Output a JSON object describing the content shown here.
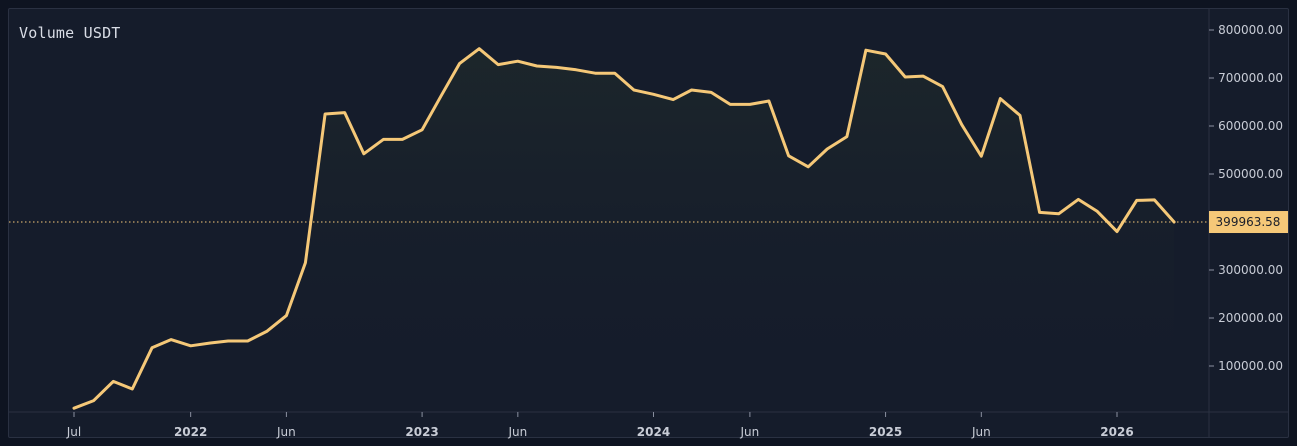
{
  "chart_data": {
    "type": "area",
    "title": "Volume USDT",
    "colors": {
      "line": "#f5c878",
      "background": "#151c2b",
      "label_bg": "#f5c878"
    },
    "ylim": [
      0,
      830000
    ],
    "y_ticks": [
      100000,
      200000,
      300000,
      400000,
      500000,
      600000,
      700000,
      800000
    ],
    "y_tick_labels": [
      "100000.00",
      "200000.00",
      "300000.00",
      "400000.00",
      "500000.00",
      "600000.00",
      "700000.00",
      "800000.00"
    ],
    "x_ticks": [
      {
        "label": "Jul",
        "date": "2021-07-01",
        "bold": false
      },
      {
        "label": "2022",
        "date": "2022-01-01",
        "bold": true
      },
      {
        "label": "Jun",
        "date": "2022-06-01",
        "bold": false
      },
      {
        "label": "2023",
        "date": "2023-01-01",
        "bold": true
      },
      {
        "label": "Jun",
        "date": "2023-06-01",
        "bold": false
      },
      {
        "label": "2024",
        "date": "2024-01-01",
        "bold": true
      },
      {
        "label": "Jun",
        "date": "2024-06-01",
        "bold": false
      },
      {
        "label": "2025",
        "date": "2025-01-01",
        "bold": true
      },
      {
        "label": "Jun",
        "date": "2025-06-01",
        "bold": false
      },
      {
        "label": "2026",
        "date": "2026-01-01",
        "bold": true
      }
    ],
    "last_value_label": "399963.58",
    "series": [
      {
        "points": [
          [
            "2021-07-01",
            12000
          ],
          [
            "2021-08-01",
            28000
          ],
          [
            "2021-09-01",
            68000
          ],
          [
            "2021-10-01",
            52000
          ],
          [
            "2021-11-01",
            138000
          ],
          [
            "2021-12-01",
            155000
          ],
          [
            "2022-01-01",
            142000
          ],
          [
            "2022-02-01",
            148000
          ],
          [
            "2022-03-01",
            152000
          ],
          [
            "2022-04-01",
            152000
          ],
          [
            "2022-05-01",
            172000
          ],
          [
            "2022-06-01",
            205000
          ],
          [
            "2022-07-01",
            315000
          ],
          [
            "2022-08-01",
            625000
          ],
          [
            "2022-09-01",
            628000
          ],
          [
            "2022-10-01",
            542000
          ],
          [
            "2022-11-01",
            572000
          ],
          [
            "2022-12-01",
            572000
          ],
          [
            "2023-01-01",
            592000
          ],
          [
            "2023-02-01",
            665000
          ],
          [
            "2023-03-01",
            730000
          ],
          [
            "2023-04-01",
            761000
          ],
          [
            "2023-05-01",
            728000
          ],
          [
            "2023-06-01",
            735000
          ],
          [
            "2023-07-01",
            725000
          ],
          [
            "2023-08-01",
            722000
          ],
          [
            "2023-09-01",
            717000
          ],
          [
            "2023-10-01",
            710000
          ],
          [
            "2023-11-01",
            710000
          ],
          [
            "2023-12-01",
            675000
          ],
          [
            "2024-01-01",
            666000
          ],
          [
            "2024-02-01",
            655000
          ],
          [
            "2024-03-01",
            675000
          ],
          [
            "2024-04-01",
            670000
          ],
          [
            "2024-05-01",
            645000
          ],
          [
            "2024-06-01",
            645000
          ],
          [
            "2024-07-01",
            652000
          ],
          [
            "2024-08-01",
            538000
          ],
          [
            "2024-09-01",
            515000
          ],
          [
            "2024-10-01",
            552000
          ],
          [
            "2024-11-01",
            578000
          ],
          [
            "2024-12-01",
            758000
          ],
          [
            "2025-01-01",
            750000
          ],
          [
            "2025-02-01",
            702000
          ],
          [
            "2025-03-01",
            704000
          ],
          [
            "2025-04-01",
            682000
          ],
          [
            "2025-05-01",
            603000
          ],
          [
            "2025-06-01",
            537000
          ],
          [
            "2025-07-01",
            657000
          ],
          [
            "2025-08-01",
            622000
          ],
          [
            "2025-09-01",
            420000
          ],
          [
            "2025-10-01",
            417000
          ],
          [
            "2025-11-01",
            447000
          ],
          [
            "2025-12-01",
            422000
          ],
          [
            "2026-01-01",
            380000
          ],
          [
            "2026-02-01",
            445000
          ],
          [
            "2026-03-01",
            446000
          ],
          [
            "2026-04-01",
            399964
          ]
        ]
      }
    ]
  }
}
